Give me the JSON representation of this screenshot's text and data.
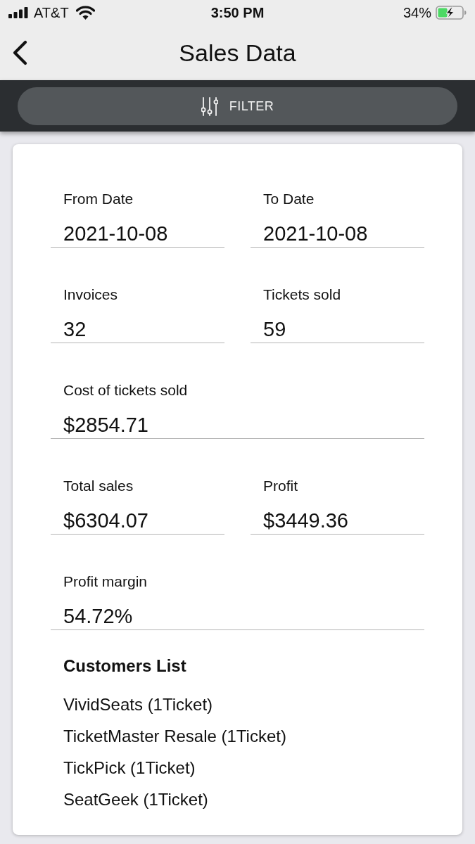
{
  "status_bar": {
    "carrier": "AT&T",
    "time": "3:50 PM",
    "battery": "34%"
  },
  "nav": {
    "title": "Sales Data"
  },
  "filter_button": {
    "label": "FILTER"
  },
  "fields": [
    {
      "kind": "half",
      "label": "From Date",
      "value": "2021-10-08"
    },
    {
      "kind": "half",
      "label": "To Date",
      "value": "2021-10-08"
    },
    {
      "kind": "half",
      "label": "Invoices",
      "value": "32"
    },
    {
      "kind": "half",
      "label": "Tickets sold",
      "value": "59"
    },
    {
      "kind": "full",
      "label": "Cost of tickets sold",
      "value": "$2854.71"
    },
    {
      "kind": "half",
      "label": "Total sales",
      "value": "$6304.07"
    },
    {
      "kind": "half",
      "label": "Profit",
      "value": "$3449.36"
    },
    {
      "kind": "full",
      "label": "Profit margin",
      "value": "54.72%"
    }
  ],
  "customers": {
    "heading": "Customers List",
    "items": [
      "VividSeats (1Ticket)",
      "TicketMaster Resale (1Ticket)",
      "TickPick (1Ticket)",
      "SeatGeek (1Ticket)"
    ]
  }
}
